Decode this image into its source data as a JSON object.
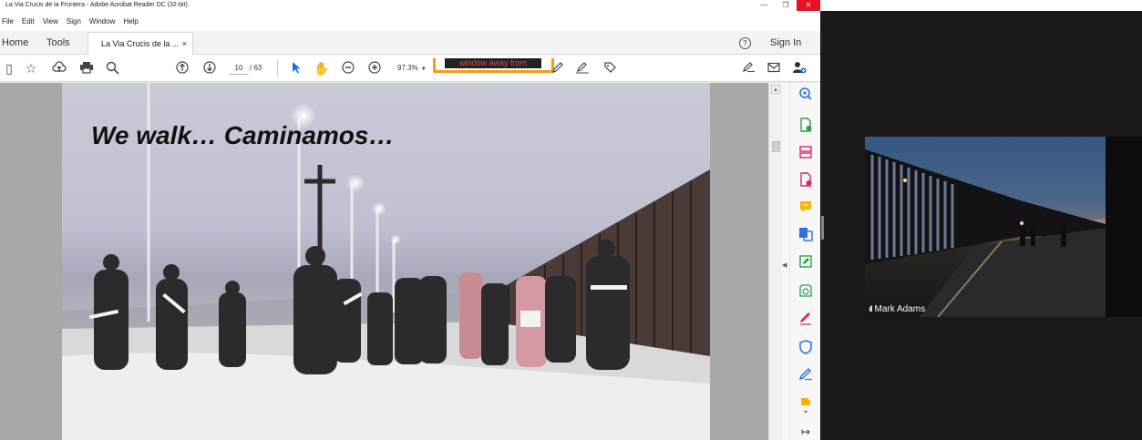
{
  "window": {
    "title": "La Via Crucis de la Frontera - Adobe Acrobat Reader DC (32-bit)",
    "min": "—",
    "max": "❐",
    "close": "✕"
  },
  "menu": [
    "File",
    "Edit",
    "View",
    "Sign",
    "Window",
    "Help"
  ],
  "tabs": {
    "home": "Home",
    "tools": "Tools",
    "document": "La Via Crucis de la ...",
    "close": "×",
    "help": "?",
    "signin": "Sign In"
  },
  "toolbar": {
    "page_current": "10",
    "page_total": "/ 63",
    "zoom": "97.3%",
    "overlay_text": "window away from"
  },
  "slide": {
    "title": "We walk… Caminamos…"
  },
  "video": {
    "participant_name": "Mark Adams",
    "signal": "ıll"
  },
  "colors": {
    "acrobat_blue": "#1473e6",
    "close_red": "#e81123",
    "tool_red": "#e0245e",
    "tool_yellow": "#f5b400",
    "tool_green": "#2e9e4f",
    "tool_blue": "#2d6fe0"
  },
  "icons": {
    "tools_pane": [
      "zoom-in-icon",
      "create-pdf-icon",
      "organize-pages-icon",
      "export-pdf-icon",
      "comment-icon",
      "combine-files-icon",
      "edit-pdf-icon",
      "fill-sign-icon",
      "sign-icon",
      "protect-icon",
      "certificate-icon",
      "more-tools-icon",
      "expand-pane-icon"
    ]
  }
}
